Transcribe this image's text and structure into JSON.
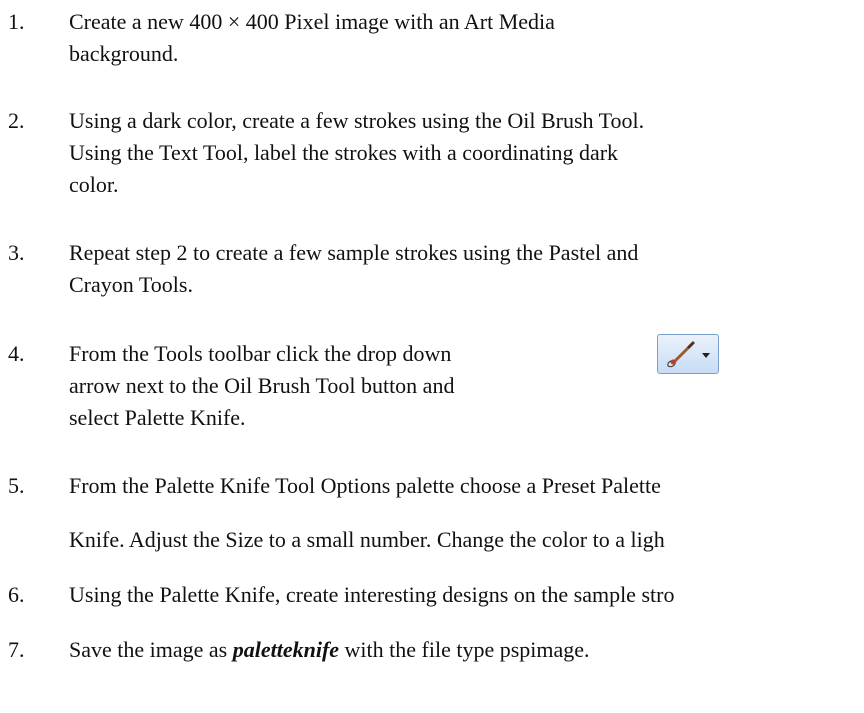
{
  "steps": [
    {
      "num": "1.",
      "lines": [
        "Create a new 400 × 400 Pixel image with an Art Media",
        "background."
      ]
    },
    {
      "num": "2.",
      "lines": [
        "Using a dark color, create a few strokes using the Oil Brush Tool.",
        "Using the Text Tool, label the strokes with a coordinating dark",
        "color."
      ]
    },
    {
      "num": "3.",
      "lines": [
        "Repeat step 2 to create a few sample strokes using the Pastel and",
        "Crayon Tools."
      ]
    },
    {
      "num": "4.",
      "lines": [
        "From the Tools toolbar click the drop down",
        "arrow next to the Oil Brush Tool button and",
        "select Palette Knife."
      ]
    },
    {
      "num": "5.",
      "lines": [
        "From the Palette Knife Tool Options palette choose a Preset Palette",
        "Knife. Adjust the Size to a small number. Change the color to a ligh"
      ]
    },
    {
      "num": "6.",
      "lines": [
        "Using the Palette Knife, create interesting designs on the sample stro"
      ]
    },
    {
      "num": "7.",
      "prefix": "Save the image as ",
      "filename": "paletteknife",
      "suffix": " with the file type pspimage."
    }
  ],
  "icons": {
    "oil_brush": "oil-brush-dropdown-icon"
  }
}
